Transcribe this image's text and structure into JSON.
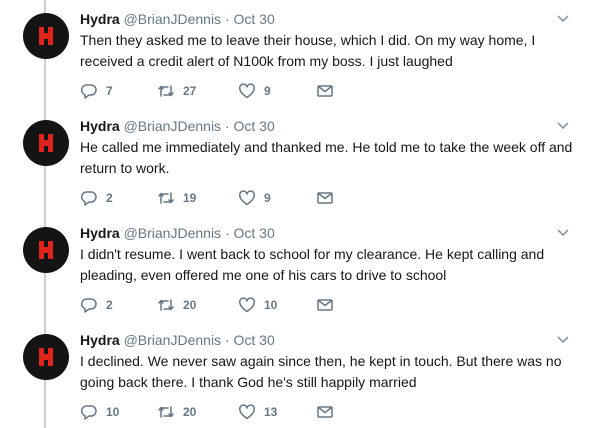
{
  "tweets": [
    {
      "author": "Hydra",
      "handle": "@BrianJDennis",
      "separator": "·",
      "date": "Oct 30",
      "text": "Then they asked me to leave their house, which I did. On my way home, I received a credit alert of N100k from my boss. I just laughed",
      "replies": "7",
      "retweets": "27",
      "likes": "9"
    },
    {
      "author": "Hydra",
      "handle": "@BrianJDennis",
      "separator": "·",
      "date": "Oct 30",
      "text": "He called me immediately and thanked me. He told me to take the week off and return to work.",
      "replies": "2",
      "retweets": "19",
      "likes": "9"
    },
    {
      "author": "Hydra",
      "handle": "@BrianJDennis",
      "separator": "·",
      "date": "Oct 30",
      "text": "I didn't resume. I went back to school for my clearance. He kept calling and pleading, even offered me one of his cars to drive to school",
      "replies": "2",
      "retweets": "20",
      "likes": "10"
    },
    {
      "author": "Hydra",
      "handle": "@BrianJDennis",
      "separator": "·",
      "date": "Oct 30",
      "text": "I declined. We never saw again since then, he kept in touch. But there was no going back there. I thank God he's still happily married",
      "replies": "10",
      "retweets": "20",
      "likes": "13"
    }
  ],
  "icons": {
    "reply": "reply-icon",
    "retweet": "retweet-icon",
    "like": "heart-icon",
    "dm": "envelope-icon",
    "menu": "chevron-down-icon"
  },
  "colors": {
    "thread_line": "#c4cfd6",
    "secondary_text": "#657786",
    "avatar_bg": "#141414",
    "avatar_mark": "#e0241b"
  }
}
